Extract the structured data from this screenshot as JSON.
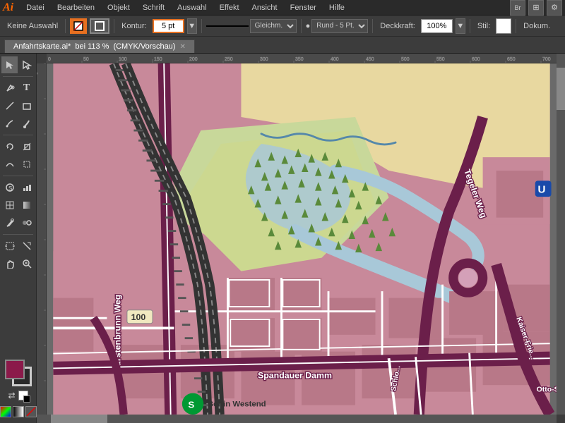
{
  "app": {
    "logo": "Ai",
    "title": "Adobe Illustrator"
  },
  "menubar": {
    "items": [
      "Datei",
      "Bearbeiten",
      "Objekt",
      "Schrift",
      "Auswahl",
      "Effekt",
      "Ansicht",
      "Fenster",
      "Hilfe"
    ]
  },
  "toolbar": {
    "selection_label": "Keine Auswahl",
    "stroke_label": "Kontur:",
    "stroke_value": "5 pt",
    "stroke_type": "Gleichm.",
    "cap_type": "Rund - 5 Pt.",
    "opacity_label": "Deckkraft:",
    "opacity_value": "100%",
    "style_label": "Stil:",
    "doc_label": "Dokum."
  },
  "tab": {
    "name": "Anfahrtskarte.ai*",
    "zoom": "bei 113 %",
    "mode": "(CMYK/Vorschau)"
  },
  "tools": [
    "arrow",
    "direct-select",
    "pen",
    "type",
    "line",
    "shape",
    "pencil",
    "brush",
    "rotate",
    "scale",
    "warp",
    "free-transform",
    "symbol",
    "column-graph",
    "mesh",
    "gradient",
    "eyedropper",
    "blend",
    "artboard",
    "slice",
    "hand",
    "zoom"
  ],
  "colors": {
    "fill": "#8B1A4A",
    "stroke": "#cccccc",
    "map_bg": "#d4a0b8",
    "road_dark": "#6b1f4a",
    "road_light": "#ffffff",
    "park_green": "#c8d89a",
    "water_blue": "#a8c8d8",
    "tree_green": "#5a8a3a",
    "sand": "#e8d8a0",
    "railway": "#333333"
  },
  "map": {
    "road_labels": [
      "Fürstenbrunn Weg",
      "Tegeler Weg",
      "Spandauer Damm",
      "Kaiser-Friedrich-Str.",
      "Otto-S."
    ],
    "road_number": "100",
    "station_label": "Berlin Westend",
    "station_icon": "S"
  }
}
